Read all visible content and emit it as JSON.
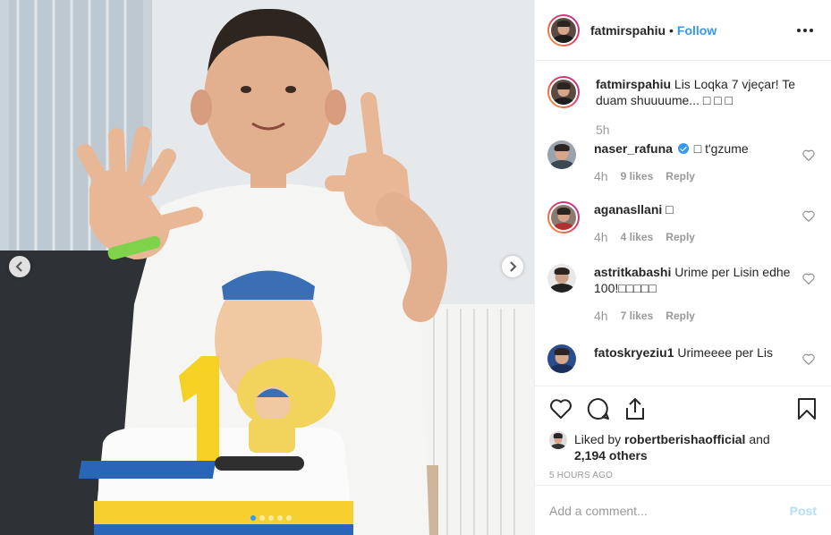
{
  "post": {
    "image_alt": "Boy holding up seven fingers behind a birthday cake topped with a number 1 candle and a Jeffy figure",
    "carousel": {
      "slide_count": 5,
      "active_index": 0
    }
  },
  "header": {
    "username": "fatmirspahiu",
    "separator": "•",
    "follow_label": "Follow"
  },
  "caption": {
    "username": "fatmirspahiu",
    "text": "Lis Loqka 7 vjeçar! Te duam shuuuume... □ □ □",
    "time": "5h"
  },
  "comments": [
    {
      "username": "naser_rafuna",
      "verified": true,
      "text": "□ t'gzume",
      "time": "4h",
      "likes": "9 likes",
      "reply": "Reply"
    },
    {
      "username": "aganasllani",
      "verified": false,
      "text": "□",
      "time": "4h",
      "likes": "4 likes",
      "reply": "Reply"
    },
    {
      "username": "astritkabashi",
      "verified": false,
      "text": "Urime per Lisin edhe 100!□□□□□",
      "time": "4h",
      "likes": "7 likes",
      "reply": "Reply"
    },
    {
      "username": "fatoskryeziu1",
      "verified": false,
      "text": "Urimeeee per Lis",
      "time": "",
      "likes": "",
      "reply": ""
    }
  ],
  "likes": {
    "prefix": "Liked by",
    "user": "robertberishaofficial",
    "connector": "and",
    "others": "2,194 others"
  },
  "timestamp": "5 HOURS AGO",
  "add_comment": {
    "placeholder": "Add a comment...",
    "post_label": "Post"
  },
  "colors": {
    "link_blue": "#3897f0",
    "muted_text": "#999999",
    "post_disabled": "#b2dffc",
    "border": "#efefef"
  }
}
